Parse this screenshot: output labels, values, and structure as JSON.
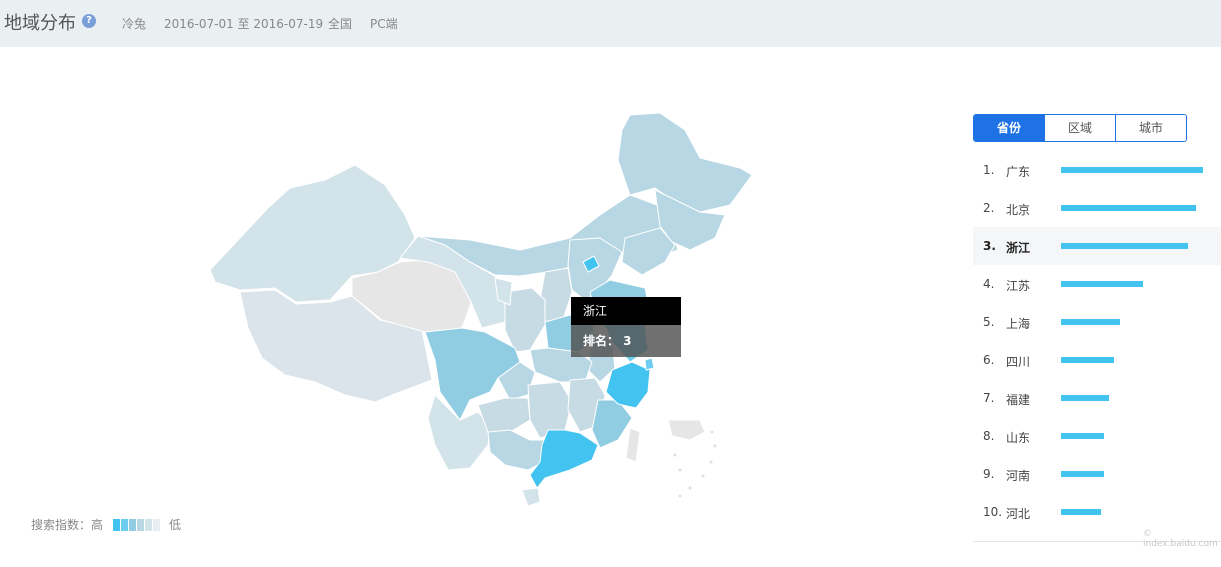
{
  "header": {
    "title": "地域分布",
    "help_icon": "?",
    "keyword": "冷兔",
    "date_range": "2016-07-01 至 2016-07-19",
    "region": "全国",
    "device": "PC端"
  },
  "tooltip": {
    "province": "浙江",
    "rank_text": "排名： 3"
  },
  "legend": {
    "prefix": "搜索指数：高",
    "suffix": "低",
    "colors": [
      "#42c3f0",
      "#6dcdee",
      "#90cde2",
      "#b7d7e4",
      "#d2e3ea",
      "#e6eef2"
    ]
  },
  "tabs": [
    {
      "label": "省份",
      "active": true
    },
    {
      "label": "区域",
      "active": false
    },
    {
      "label": "城市",
      "active": false
    }
  ],
  "ranking": [
    {
      "num": "1.",
      "name": "广东",
      "value": 100
    },
    {
      "num": "2.",
      "name": "北京",
      "value": 95
    },
    {
      "num": "3.",
      "name": "浙江",
      "value": 89.5,
      "active": true
    },
    {
      "num": "4.",
      "name": "江苏",
      "value": 57.5
    },
    {
      "num": "5.",
      "name": "上海",
      "value": 41.5
    },
    {
      "num": "6.",
      "name": "四川",
      "value": 37
    },
    {
      "num": "7.",
      "name": "福建",
      "value": 33.5
    },
    {
      "num": "8.",
      "name": "山东",
      "value": 30.5
    },
    {
      "num": "9.",
      "name": "河南",
      "value": 30
    },
    {
      "num": "10.",
      "name": "河北",
      "value": 28
    }
  ],
  "watermark": "© index.baidu.com",
  "colors": {
    "accent": "#1e72e6",
    "bar": "#42c3f0",
    "highlight": "#42c3f0",
    "mid": "#90cde2",
    "light": "#b7d7e4",
    "pale": "#d2e3ea",
    "grey": "#e6e6e6"
  }
}
